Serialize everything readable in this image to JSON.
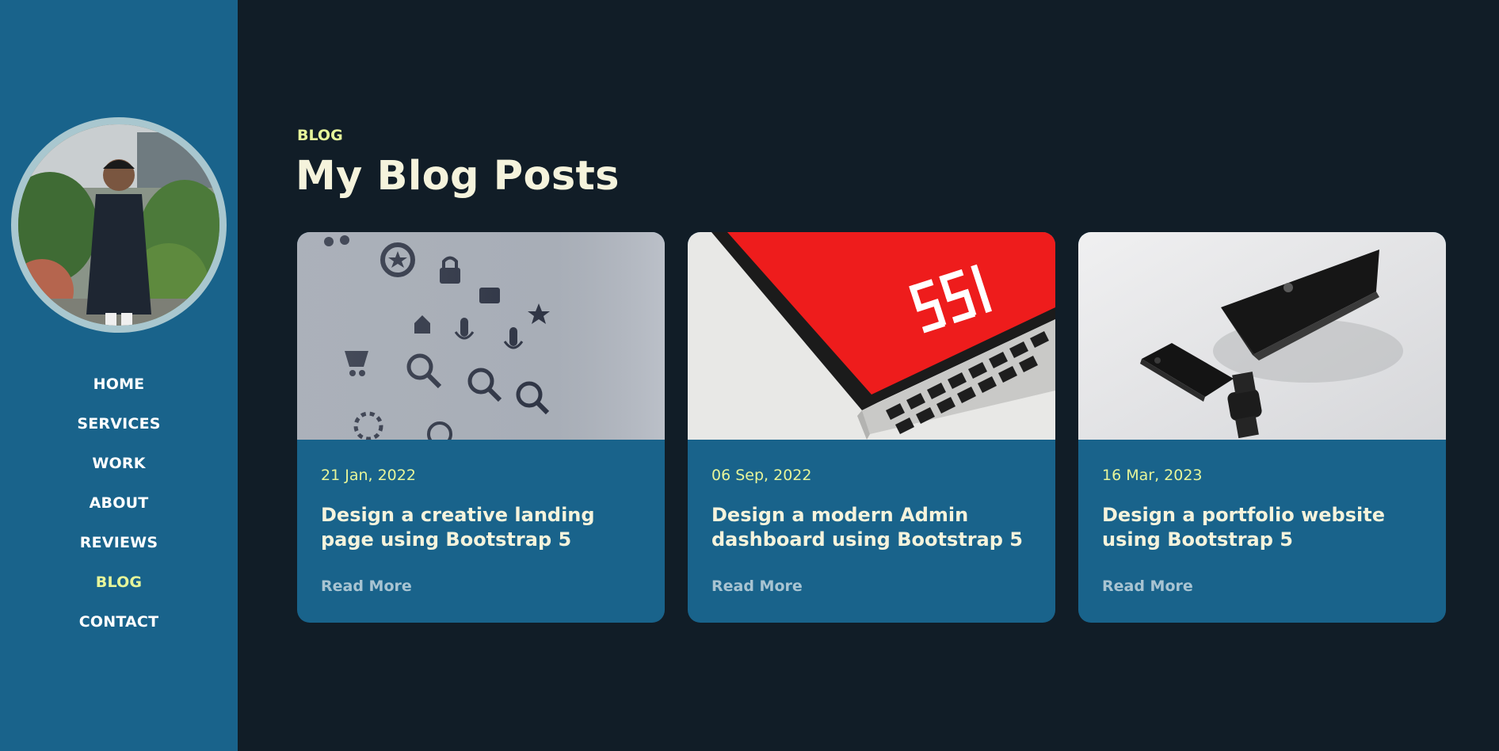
{
  "sidebar": {
    "profile_alt": "profile photo",
    "nav": [
      {
        "label": "HOME",
        "active": false
      },
      {
        "label": "SERVICES",
        "active": false
      },
      {
        "label": "WORK",
        "active": false
      },
      {
        "label": "ABOUT",
        "active": false
      },
      {
        "label": "REVIEWS",
        "active": false
      },
      {
        "label": "BLOG",
        "active": true
      },
      {
        "label": "CONTACT",
        "active": false
      }
    ]
  },
  "section": {
    "eyebrow": "BLOG",
    "title": "My Blog Posts"
  },
  "posts": [
    {
      "date": "21 Jan, 2022",
      "title": "Design a creative landing page using Bootstrap 5",
      "link": "Read More",
      "image": "icons-grid-image"
    },
    {
      "date": "06 Sep, 2022",
      "title": "Design a modern Admin dashboard using Bootstrap 5",
      "link": "Read More",
      "image": "laptop-red-screen-image"
    },
    {
      "date": "16 Mar, 2023",
      "title": "Design a portfolio website using Bootstrap 5",
      "link": "Read More",
      "image": "black-devices-image"
    }
  ],
  "colors": {
    "background": "#111d27",
    "sidebar": "#19638b",
    "card": "#19638b",
    "accent": "#e6f59a",
    "heading": "#f5f3dc"
  }
}
